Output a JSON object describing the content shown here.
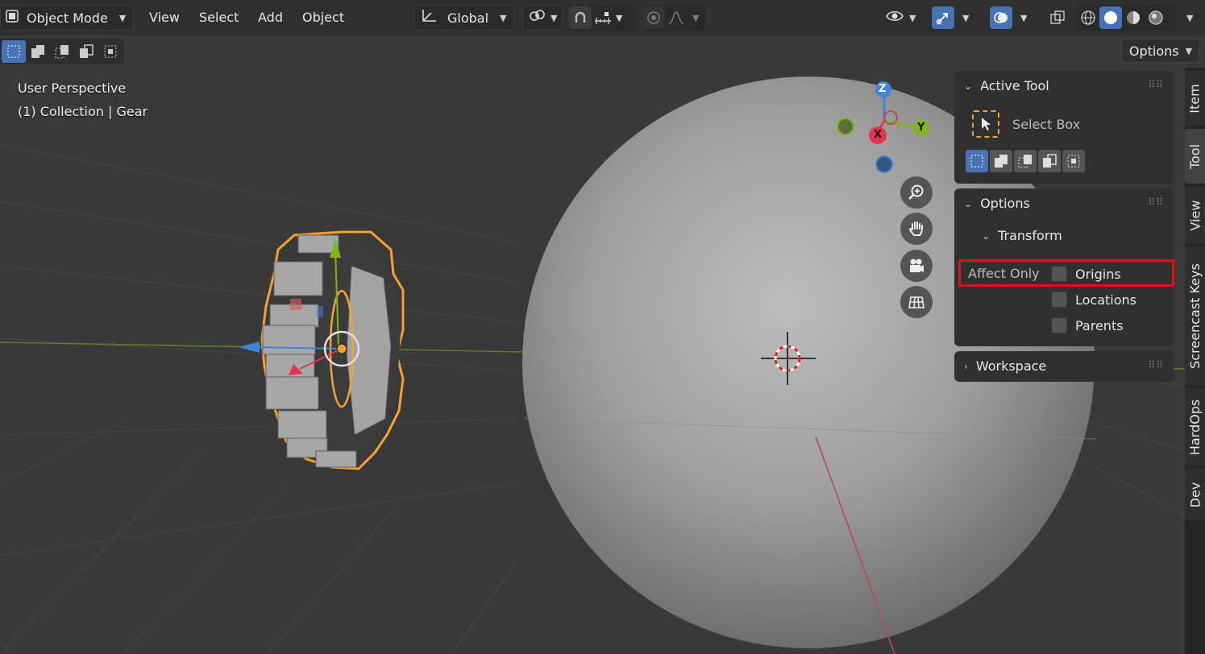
{
  "header": {
    "mode_label": "Object Mode",
    "menus": [
      "View",
      "Select",
      "Add",
      "Object"
    ],
    "orientation_label": "Global",
    "options_label": "Options"
  },
  "viewport": {
    "perspective_label": "User Perspective",
    "collection_label": "(1) Collection | Gear",
    "gizmo": {
      "z": "Z",
      "y": "Y",
      "x": "X"
    }
  },
  "panel": {
    "active_tool": {
      "title": "Active Tool",
      "tool_name": "Select Box"
    },
    "options": {
      "title": "Options",
      "transform_title": "Transform",
      "affect_only_label": "Affect Only",
      "checkboxes": [
        {
          "label": "Origins",
          "checked": false
        },
        {
          "label": "Locations",
          "checked": false
        },
        {
          "label": "Parents",
          "checked": false
        }
      ]
    },
    "workspace": {
      "title": "Workspace"
    }
  },
  "tabs": [
    "Item",
    "Tool",
    "View",
    "Screencast Keys",
    "HardOps",
    "Dev"
  ],
  "colors": {
    "accent": "#4772b3",
    "selection_outline": "#f5a031",
    "highlight_box": "#e0101a",
    "axis_x": "#e8344e",
    "axis_y": "#7cb81a",
    "axis_z": "#3d86d9"
  }
}
